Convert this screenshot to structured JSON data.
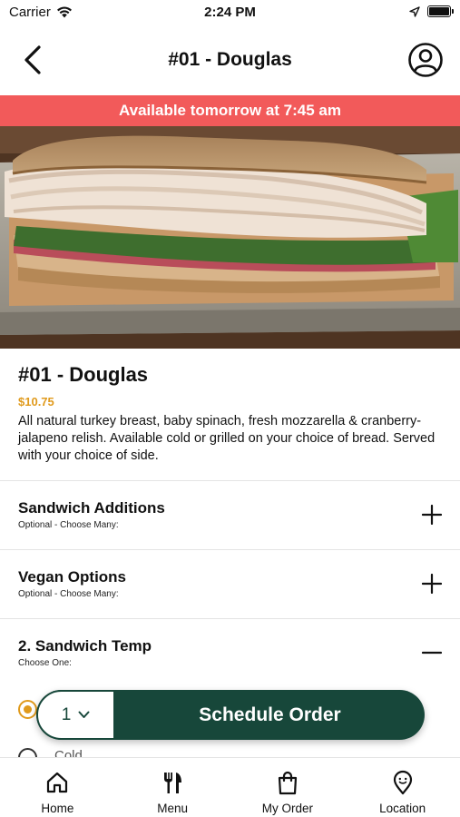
{
  "status_bar": {
    "carrier": "Carrier",
    "time": "2:24 PM"
  },
  "nav": {
    "title": "#01 - Douglas"
  },
  "availability": {
    "text": "Available tomorrow at 7:45 am",
    "color": "#f25a5a"
  },
  "item": {
    "name": "#01 - Douglas",
    "price": "$10.75",
    "description": "All natural turkey breast, baby spinach, fresh mozzarella & cranberry-jalapeno relish.  Available cold or grilled on your choice of bread.   Served with your choice of side."
  },
  "options": [
    {
      "title": "Sandwich Additions",
      "subtitle": "Optional - Choose Many:",
      "state": "collapsed",
      "icon": "plus-icon"
    },
    {
      "title": "Vegan Options",
      "subtitle": "Optional - Choose Many:",
      "state": "collapsed",
      "icon": "plus-icon"
    },
    {
      "title": "2. Sandwich Temp",
      "subtitle": "Choose One:",
      "state": "expanded",
      "icon": "minus-icon"
    }
  ],
  "sandwich_temp": {
    "choices": [
      {
        "label": "Cold",
        "selected": false
      }
    ]
  },
  "order_bar": {
    "quantity": "1",
    "button_label": "Schedule Order",
    "color": "#17473a"
  },
  "tabs": [
    {
      "label": "Home",
      "icon": "home-icon"
    },
    {
      "label": "Menu",
      "icon": "fork-knife-icon"
    },
    {
      "label": "My Order",
      "icon": "shopping-bag-icon"
    },
    {
      "label": "Location",
      "icon": "location-pin-icon"
    }
  ],
  "colors": {
    "accent": "#e09a1c",
    "primary": "#17473a",
    "banner": "#f25a5a"
  }
}
